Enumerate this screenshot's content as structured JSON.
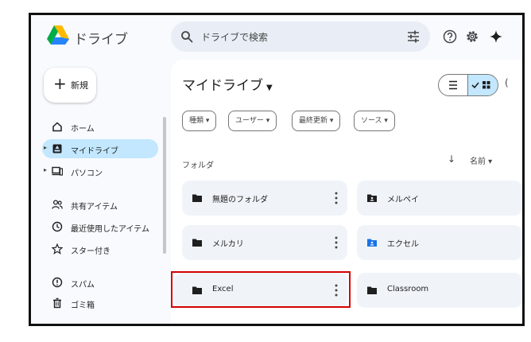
{
  "header": {
    "app_title": "ドライブ",
    "search_placeholder": "ドライブで検索",
    "icons": [
      "help-icon",
      "settings-icon",
      "gemini-spark-icon"
    ]
  },
  "sidebar": {
    "new_label": "新規",
    "items": [
      {
        "label": "ホーム",
        "icon": "home-icon",
        "active": false
      },
      {
        "label": "マイドライブ",
        "icon": "my-drive-icon",
        "active": true
      },
      {
        "label": "パソコン",
        "icon": "computers-icon",
        "active": false
      },
      {
        "label": "共有アイテム",
        "icon": "shared-icon",
        "active": false
      },
      {
        "label": "最近使用したアイテム",
        "icon": "recent-icon",
        "active": false
      },
      {
        "label": "スター付き",
        "icon": "star-icon",
        "active": false
      },
      {
        "label": "スパム",
        "icon": "spam-icon",
        "active": false
      },
      {
        "label": "ゴミ箱",
        "icon": "trash-icon",
        "active": false
      }
    ]
  },
  "main": {
    "title": "マイドライブ",
    "filters": [
      "種類",
      "ユーザー",
      "最終更新",
      "ソース"
    ],
    "section_label": "フォルダ",
    "sort_label": "名前",
    "folders": [
      {
        "name": "無題のフォルダ",
        "type": "folder"
      },
      {
        "name": "メルペイ",
        "type": "shared-folder"
      },
      {
        "name": "メルカリ",
        "type": "folder"
      },
      {
        "name": "エクセル",
        "type": "shared-folder-blue"
      },
      {
        "name": "Excel",
        "type": "folder",
        "highlighted": true
      },
      {
        "name": "Classroom",
        "type": "folder"
      }
    ]
  },
  "colors": {
    "accent": "#c2e7ff",
    "highlight_box": "#d40000",
    "card": "#f0f4f9",
    "blue_folder": "#1a73e8"
  }
}
